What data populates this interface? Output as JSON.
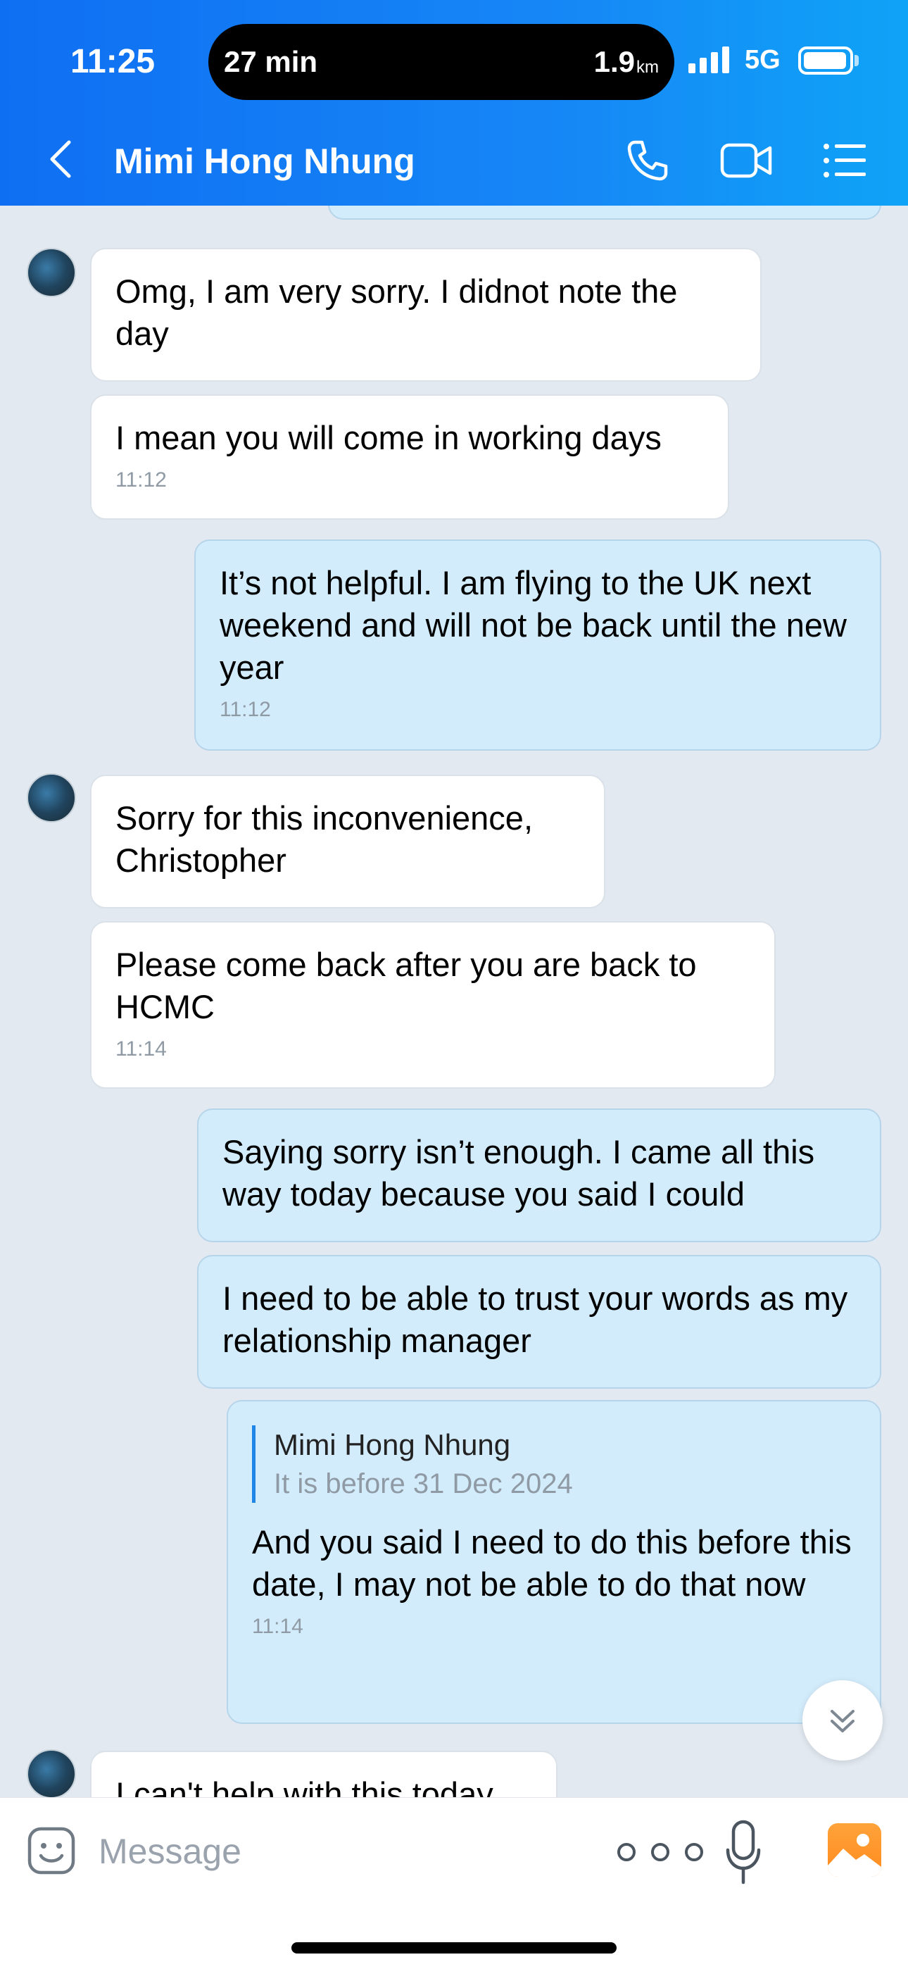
{
  "status_bar": {
    "time": "11:25",
    "island_left": "27 min",
    "island_right": "1.9",
    "island_unit": "km",
    "network": "5G"
  },
  "header": {
    "title": "Mimi Hong Nhung",
    "icons": [
      "back-icon",
      "call-icon",
      "video-call-icon",
      "menu-icon"
    ]
  },
  "messages": [
    {
      "dir": "in",
      "text": "Omg, I am very sorry. I didnot note the day",
      "time": ""
    },
    {
      "dir": "in",
      "text": "I mean you will come in working days",
      "time": "11:12"
    },
    {
      "dir": "out",
      "text": "It’s not helpful. I am flying to the UK next weekend and will not be back until the new year",
      "time": "11:12"
    },
    {
      "dir": "in",
      "text": "Sorry for this inconvenience, Christopher",
      "time": ""
    },
    {
      "dir": "in",
      "text": "Please come back after you are back to HCMC",
      "time": "11:14"
    },
    {
      "dir": "out",
      "text": "Saying sorry isn’t enough. I came all this way today because you said I could",
      "time": ""
    },
    {
      "dir": "out",
      "text": "I need to be able to trust your words as my relationship manager",
      "time": ""
    },
    {
      "dir": "out",
      "quote_name": "Mimi Hong Nhung",
      "quote_text": "It is before 31 Dec 2024",
      "text": "And you said I need to do this before this date, I may not be able to do that now",
      "time": "11:14"
    },
    {
      "dir": "in",
      "text": "I can't help with this today",
      "time": ""
    }
  ],
  "input": {
    "placeholder": "Message"
  },
  "colors": {
    "header_start": "#0f6ff2",
    "header_end": "#0fa3f7",
    "outgoing_bubble": "#d3ecfb",
    "incoming_bubble": "#ffffff",
    "chat_background": "#e2e9f1"
  }
}
